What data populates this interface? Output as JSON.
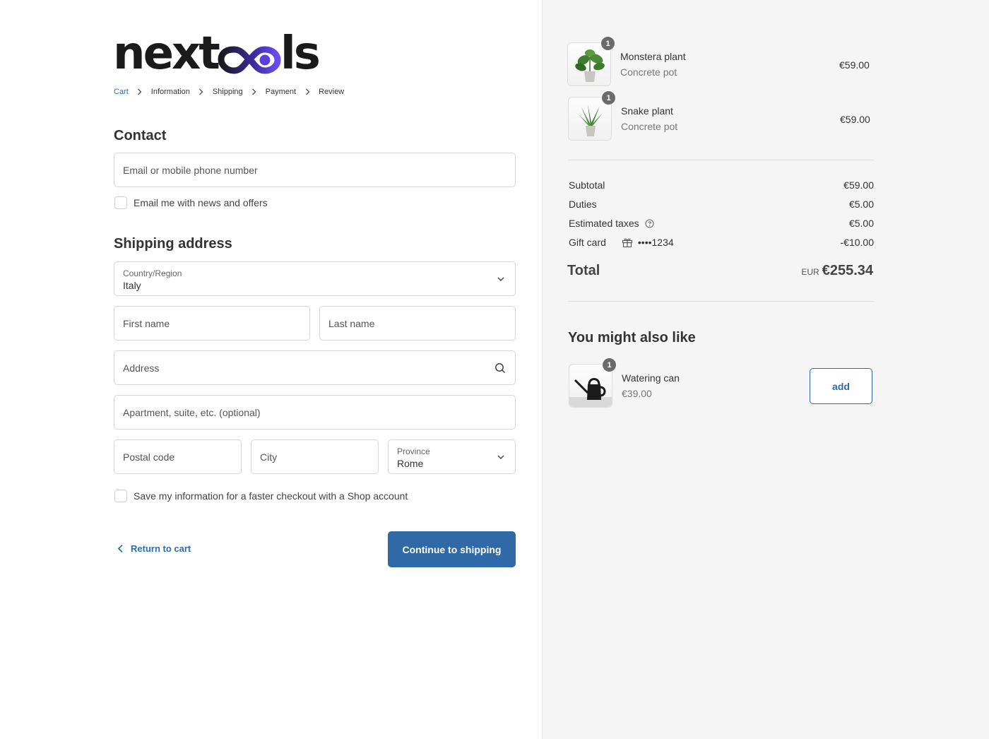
{
  "brand": {
    "logo_prefix": "next",
    "logo_suffix": "ls",
    "logo_accent": "#5b3fd9"
  },
  "breadcrumb": [
    {
      "label": "Cart",
      "active": true
    },
    {
      "label": "Information",
      "active": false
    },
    {
      "label": "Shipping",
      "active": false
    },
    {
      "label": "Payment",
      "active": false
    },
    {
      "label": "Review",
      "active": false
    }
  ],
  "contact": {
    "heading": "Contact",
    "email_placeholder": "Email or mobile phone number",
    "newsletter_label": "Email me with news and offers"
  },
  "shipping": {
    "heading": "Shipping address",
    "country_label": "Country/Region",
    "country_value": "Italy",
    "first_name_placeholder": "First name",
    "last_name_placeholder": "Last name",
    "address_placeholder": "Address",
    "apartment_placeholder": "Apartment, suite, etc. (optional)",
    "postal_placeholder": "Postal code",
    "city_placeholder": "City",
    "province_label": "Province",
    "province_value": "Rome",
    "save_info_label": "Save my information for a faster checkout with a Shop account"
  },
  "actions": {
    "return_label": "Return to cart",
    "continue_label": "Continue to shipping"
  },
  "cart_items": [
    {
      "name": "Monstera plant",
      "variant": "Concrete pot",
      "price": "€59.00",
      "qty": "1"
    },
    {
      "name": "Snake plant",
      "variant": "Concrete pot",
      "price": "€59.00",
      "qty": "1"
    }
  ],
  "summary": {
    "subtotal_label": "Subtotal",
    "subtotal_value": "€59.00",
    "duties_label": "Duties",
    "duties_value": "€5.00",
    "taxes_label": "Estimated taxes",
    "taxes_value": "€5.00",
    "gift_label": "Gift card",
    "gift_code": "••••1234",
    "gift_value": "-€10.00",
    "total_label": "Total",
    "currency": "EUR",
    "total_value": "€255.34"
  },
  "recommendations": {
    "heading": "You might also like",
    "items": [
      {
        "name": "Watering can",
        "price": "€39.00",
        "qty": "1",
        "add_label": "add"
      }
    ]
  },
  "colors": {
    "primary": "#2f69a8",
    "link": "#2b6cb0",
    "sidebar_bg": "#f5f5f5"
  }
}
